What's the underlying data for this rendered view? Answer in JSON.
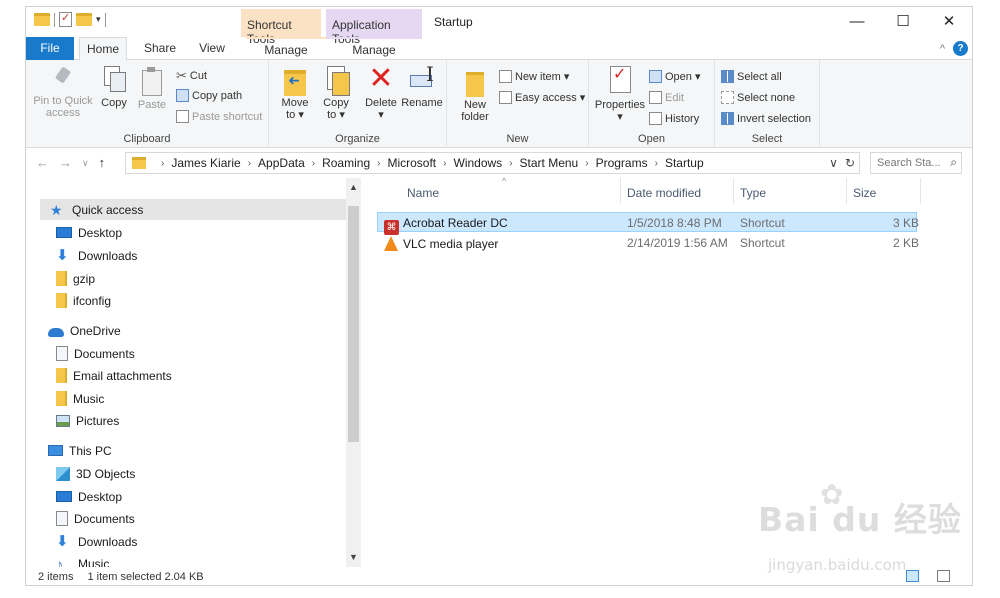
{
  "window": {
    "title": "Startup",
    "context_tabs": {
      "shortcut_tools": "Shortcut Tools",
      "application_tools": "Application Tools"
    },
    "controls": {
      "minimize": "—",
      "maximize": "☐",
      "close": "✕"
    }
  },
  "ribbon_tabs": {
    "file": "File",
    "home": "Home",
    "share": "Share",
    "view": "View",
    "manage_shortcut": "Manage",
    "manage_app": "Manage"
  },
  "ribbon": {
    "clipboard": {
      "label": "Clipboard",
      "pin": "Pin to Quick access",
      "copy": "Copy",
      "paste": "Paste",
      "cut": "Cut",
      "copy_path": "Copy path",
      "paste_shortcut": "Paste shortcut"
    },
    "organize": {
      "label": "Organize",
      "move_to": "Move to ▾",
      "move_to_a": "Move",
      "move_to_b": "to ▾",
      "copy_to_a": "Copy",
      "copy_to_b": "to ▾",
      "delete": "Delete",
      "delete_caret": "▾",
      "rename": "Rename"
    },
    "new": {
      "label": "New",
      "new_folder_a": "New",
      "new_folder_b": "folder",
      "new_item": "New item ▾",
      "easy_access": "Easy access ▾"
    },
    "open": {
      "label": "Open",
      "properties": "Properties",
      "properties_caret": "▾",
      "open": "Open ▾",
      "edit": "Edit",
      "history": "History"
    },
    "select": {
      "label": "Select",
      "select_all": "Select all",
      "select_none": "Select none",
      "invert_selection": "Invert selection"
    }
  },
  "address": {
    "crumbs": [
      "James Kiarie",
      "AppData",
      "Roaming",
      "Microsoft",
      "Windows",
      "Start Menu",
      "Programs",
      "Startup"
    ],
    "search_placeholder": "Search Sta..."
  },
  "nav": {
    "quick_access": "Quick access",
    "quick_items": [
      "Desktop",
      "Downloads",
      "gzip",
      "ifconfig"
    ],
    "onedrive": "OneDrive",
    "onedrive_items": [
      "Documents",
      "Email attachments",
      "Music",
      "Pictures"
    ],
    "this_pc": "This PC",
    "pc_items": [
      "3D Objects",
      "Desktop",
      "Documents",
      "Downloads",
      "Music"
    ]
  },
  "columns": {
    "name": "Name",
    "date": "Date modified",
    "type": "Type",
    "size": "Size"
  },
  "files": [
    {
      "name": "Acrobat Reader DC",
      "date": "1/5/2018 8:48 PM",
      "type": "Shortcut",
      "size": "3 KB",
      "selected": true,
      "icon": "acrobat-icon"
    },
    {
      "name": "VLC media player",
      "date": "2/14/2019 1:56 AM",
      "type": "Shortcut",
      "size": "2 KB",
      "selected": false,
      "icon": "vlc-icon"
    }
  ],
  "status": {
    "count": "2 items",
    "selection": "1 item selected  2.04 KB"
  },
  "watermark": {
    "brand": "Bai du 经验",
    "url": "jingyan.baidu.com"
  },
  "colors": {
    "accent": "#1979ca",
    "selection": "#cce8ff",
    "shortcut_ctx": "#fce2c4",
    "app_ctx": "#e6d8f2"
  }
}
